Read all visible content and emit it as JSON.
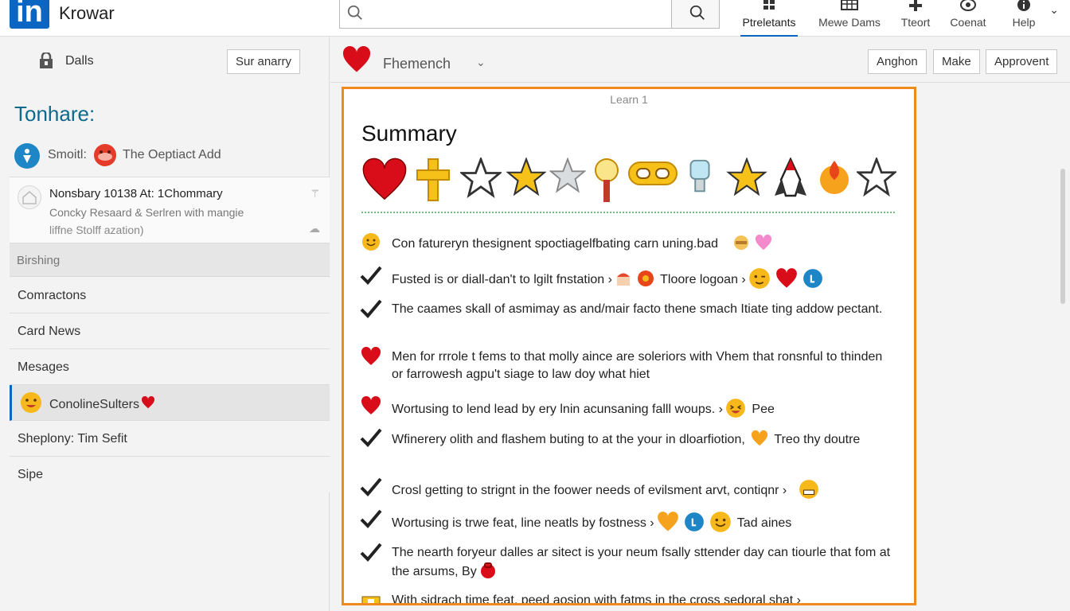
{
  "header": {
    "logo_text": "in",
    "brand": "Krowar",
    "search": {
      "placeholder": ""
    },
    "nav": [
      {
        "label": "Ptreletants",
        "icon": "grid-icon"
      },
      {
        "label": "Mewe Dams",
        "icon": "table-icon"
      },
      {
        "label": "Tteort",
        "icon": "plus-icon"
      },
      {
        "label": "Coenat",
        "icon": "eye-icon"
      },
      {
        "label": "Help",
        "icon": "info-icon"
      }
    ]
  },
  "sidebar": {
    "head_label": "Dalls",
    "summary_button": "Sur anarry",
    "title": "Tonhare:",
    "contact_name": "Smoitl:",
    "contact_desc": "The Oeptiact Add",
    "card": {
      "line1": "Nonsbary 10138 At: 1Chommary",
      "line2": "Concky Resaard & Serlren with mangie",
      "line3": "liffne Stolff azation)"
    },
    "section_header": "Birshing",
    "items": [
      {
        "label": "Comractons"
      },
      {
        "label": "Card News"
      },
      {
        "label": "Mesages"
      },
      {
        "label": "ConolineSulters"
      },
      {
        "label": "Sheplony: Tim Sefit"
      },
      {
        "label": "Sipe"
      }
    ]
  },
  "main": {
    "title": "Fhemench",
    "buttons": [
      "Anghon",
      "Make",
      "Approvent"
    ]
  },
  "doc": {
    "top_label": "Learn 1",
    "heading": "Summary",
    "items": [
      {
        "marker": "smile",
        "text": "Con faturerуn thesignent spoctiagelfbating carn uning.bad"
      },
      {
        "marker": "check",
        "text": "Fusted is or diall-dan't to lgilt fnstation",
        "tail": "Tloore logoan"
      },
      {
        "marker": "check",
        "text": "The caames skall of asmimay as and/mair facto thene smach Itiate ting addow pectant."
      },
      {
        "marker": "heart",
        "text": "Men for rrrole t fems to that molly aince are soleriors with  Vhem that ronsnful to thinden or farrowesh agpu't siage to law doy what hiet"
      },
      {
        "marker": "heart",
        "text": "Wortusing to lend lead by ery lnin acunsaning falll woups.",
        "tail": "Pee"
      },
      {
        "marker": "check",
        "text": "Wfinerery olith and flashem buting to at the your in dloarfiotion,",
        "tail": "Treo thy doutre"
      },
      {
        "marker": "check",
        "text": "Crosl getting to strignt in the foower needs of evilsment arvt, contiqnr"
      },
      {
        "marker": "check",
        "text": "Wortusing is trwe feat, line neatls by fostness",
        "tail": "Tad aines"
      },
      {
        "marker": "check",
        "text": "The nearth foryeur dalles ar sitect is your neum fsally sttender day can tiourle that fom at the arsums, By"
      },
      {
        "marker": "lock",
        "text": "With sidrach time feat, peed aosion with fatms in the cross sedoral shat"
      }
    ]
  },
  "colors": {
    "accent": "#0a66c2",
    "doc_border": "#f08a1c",
    "heart": "#d90d1a",
    "star": "#f6c21a"
  }
}
